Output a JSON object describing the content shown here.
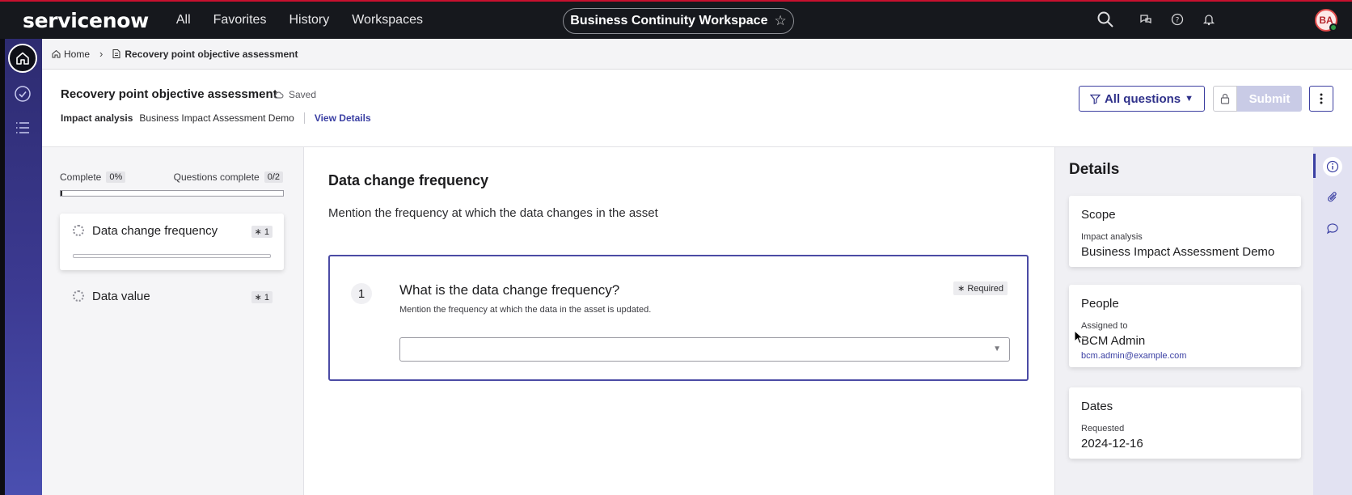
{
  "topnav": {
    "logo": "servicenow",
    "menu": [
      "All",
      "Favorites",
      "History",
      "Workspaces"
    ],
    "workspace": "Business Continuity Workspace",
    "avatar_initials": "BA",
    "icons": [
      "search-icon",
      "chat-icon",
      "help-icon",
      "bell-icon"
    ]
  },
  "breadcrumb": {
    "home": "Home",
    "current": "Recovery point objective assessment"
  },
  "header": {
    "title": "Recovery point objective assessment",
    "saved": "Saved",
    "impact_label": "Impact analysis",
    "impact_value": "Business Impact Assessment Demo",
    "view_details": "View Details",
    "filter_label": "All questions",
    "submit_label": "Submit"
  },
  "progress": {
    "complete_label": "Complete",
    "complete_value": "0%",
    "complete_fraction": 0,
    "questions_label": "Questions complete",
    "questions_value": "0/2",
    "sections": [
      {
        "label": "Data change frequency",
        "required": "∗ 1"
      },
      {
        "label": "Data value",
        "required": "∗ 1"
      }
    ]
  },
  "main": {
    "section_title": "Data change frequency",
    "section_desc": "Mention the frequency at which the data changes in the asset",
    "question": {
      "number": "1",
      "text": "What is the data change frequency?",
      "help": "Mention the frequency at which the data in the asset is updated.",
      "required": "∗ Required",
      "value": ""
    }
  },
  "details": {
    "title": "Details",
    "scope": {
      "heading": "Scope",
      "label": "Impact analysis",
      "value": "Business Impact Assessment Demo"
    },
    "people": {
      "heading": "People",
      "label": "Assigned to",
      "value": "BCM Admin",
      "email": "bcm.admin@example.com"
    },
    "dates": {
      "heading": "Dates",
      "label": "Requested",
      "value": "2024-12-16"
    }
  },
  "colors": {
    "nav_bg": "#16181d",
    "rail_top": "#2d2b70",
    "rail_bottom": "#4a4fb0",
    "accent": "#3a3fa3",
    "submit_disabled": "#c9cbe6"
  }
}
